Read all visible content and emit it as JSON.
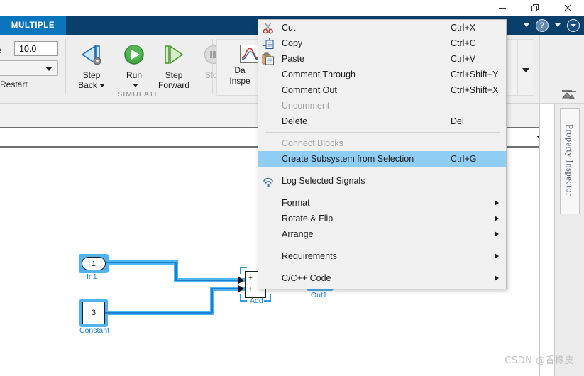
{
  "window": {
    "controls": [
      {
        "name": "minimize",
        "glyph": "—"
      },
      {
        "name": "restore",
        "glyph": "❐"
      },
      {
        "name": "close",
        "glyph": "✕"
      }
    ]
  },
  "ribbon": {
    "active_tab": "MULTIPLE",
    "help_icon": "help-icon",
    "expand_icon": "expand-ribbon-icon",
    "stop_time_label": "e",
    "stop_time_value": "10.0",
    "restart_label": "Restart",
    "simulate_group_label": "SIMULATE",
    "buttons": [
      {
        "label_line1": "Step",
        "label_line2": "Back",
        "icon": "step-back-icon",
        "disabled": false,
        "has_caret": true
      },
      {
        "label_line1": "Run",
        "label_line2": "",
        "icon": "run-icon",
        "disabled": false,
        "has_caret": true
      },
      {
        "label_line1": "Step",
        "label_line2": "Forward",
        "icon": "step-forward-icon",
        "disabled": false,
        "has_caret": false
      },
      {
        "label_line1": "Stop",
        "label_line2": "",
        "icon": "stop-icon",
        "disabled": true,
        "has_caret": false
      }
    ],
    "data_inspector": {
      "line1": "Da",
      "line2": "Inspe",
      "icon": "data-inspector-icon"
    }
  },
  "context_menu": {
    "items": [
      {
        "label": "Cut",
        "shortcut": "Ctrl+X",
        "icon": "scissors-icon",
        "disabled": false,
        "selected": false,
        "submenu": false,
        "separator_after": false
      },
      {
        "label": "Copy",
        "shortcut": "Ctrl+C",
        "icon": "copy-icon",
        "disabled": false,
        "selected": false,
        "submenu": false,
        "separator_after": false
      },
      {
        "label": "Paste",
        "shortcut": "Ctrl+V",
        "icon": "paste-icon",
        "disabled": false,
        "selected": false,
        "submenu": false,
        "separator_after": false
      },
      {
        "label": "Comment Through",
        "shortcut": "Ctrl+Shift+Y",
        "icon": "",
        "disabled": false,
        "selected": false,
        "submenu": false,
        "separator_after": false
      },
      {
        "label": "Comment Out",
        "shortcut": "Ctrl+Shift+X",
        "icon": "",
        "disabled": false,
        "selected": false,
        "submenu": false,
        "separator_after": false
      },
      {
        "label": "Uncomment",
        "shortcut": "",
        "icon": "",
        "disabled": true,
        "selected": false,
        "submenu": false,
        "separator_after": false
      },
      {
        "label": "Delete",
        "shortcut": "Del",
        "icon": "",
        "disabled": false,
        "selected": false,
        "submenu": false,
        "separator_after": true
      },
      {
        "label": "Connect Blocks",
        "shortcut": "",
        "icon": "",
        "disabled": true,
        "selected": false,
        "submenu": false,
        "separator_after": false
      },
      {
        "label": "Create Subsystem from Selection",
        "shortcut": "Ctrl+G",
        "icon": "",
        "disabled": false,
        "selected": true,
        "submenu": false,
        "separator_after": true
      },
      {
        "label": "Log Selected Signals",
        "shortcut": "",
        "icon": "signal-log-icon",
        "disabled": false,
        "selected": false,
        "submenu": false,
        "separator_after": true
      },
      {
        "label": "Format",
        "shortcut": "",
        "icon": "",
        "disabled": false,
        "selected": false,
        "submenu": true,
        "separator_after": false
      },
      {
        "label": "Rotate & Flip",
        "shortcut": "",
        "icon": "",
        "disabled": false,
        "selected": false,
        "submenu": true,
        "separator_after": false
      },
      {
        "label": "Arrange",
        "shortcut": "",
        "icon": "",
        "disabled": false,
        "selected": false,
        "submenu": true,
        "separator_after": true
      },
      {
        "label": "Requirements",
        "shortcut": "",
        "icon": "",
        "disabled": false,
        "selected": false,
        "submenu": true,
        "separator_after": true
      },
      {
        "label": "C/C++ Code",
        "shortcut": "",
        "icon": "",
        "disabled": false,
        "selected": false,
        "submenu": true,
        "separator_after": false
      }
    ]
  },
  "model": {
    "blocks": [
      {
        "name": "In1",
        "display": "1",
        "label": "In1",
        "type": "inport"
      },
      {
        "name": "Constant",
        "display": "3",
        "label": "Constant",
        "type": "constant"
      },
      {
        "name": "Add",
        "display": "",
        "label": "Add",
        "type": "sum",
        "ports": [
          "+",
          "+"
        ]
      },
      {
        "name": "Out1",
        "display": "",
        "label": "Out1",
        "type": "outport"
      }
    ]
  },
  "panels": {
    "property_inspector_title": "Property Inspector"
  },
  "watermark": "CSDN @香橡皮",
  "colors": {
    "ribbon_dark": "#0b3f6b",
    "tab_active": "#0a74bd",
    "menu_bg": "#f0f0f0",
    "menu_selected": "#90cdf4",
    "signal_blue": "#1b7fd4",
    "selection_glow": "#4fb4f0"
  }
}
